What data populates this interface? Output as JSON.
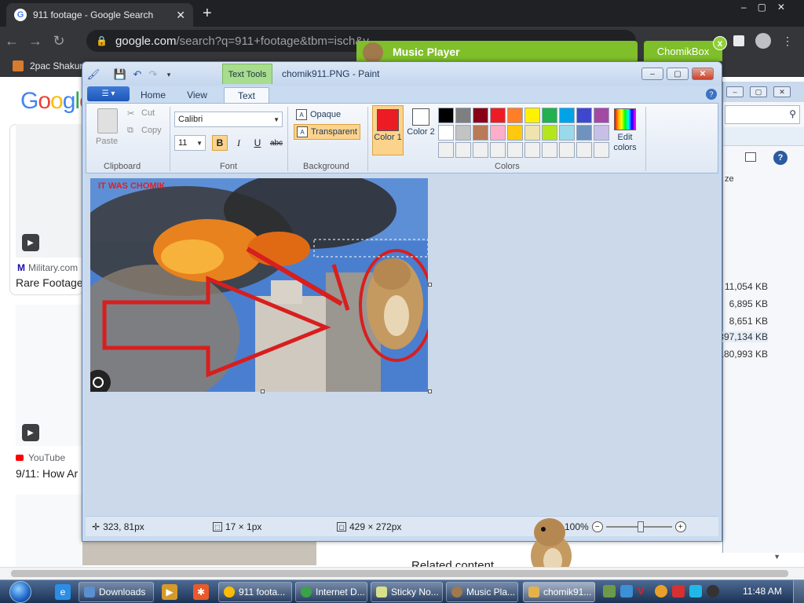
{
  "chrome": {
    "tab_title": "911 footage - Google Search",
    "tab_close": "✕",
    "new_tab": "+",
    "url_host": "google.com",
    "url_rest": "/search?q=911+footage&tbm=isch&v",
    "bookmark": "2pac Shakur"
  },
  "google": {
    "logo": [
      "G",
      "o",
      "o",
      "g",
      "l",
      "e"
    ],
    "result1_source": "Military.com",
    "result1_title": "Rare Footage",
    "result2_source": "YouTube",
    "result2_title": "9/11: How Ar",
    "related": "Related content"
  },
  "explorer": {
    "sizes": [
      "11,054 KB",
      "6,895 KB",
      "8,651 KB",
      "397,134 KB",
      "180,993 KB"
    ],
    "col_header": "ze"
  },
  "music_player": {
    "title": "Music Player"
  },
  "chomikbox": {
    "title": "ChomikBox",
    "close": "x"
  },
  "paint": {
    "doc_title": "chomik911.PNG - Paint",
    "context_tab": "Text Tools",
    "tabs": [
      "Home",
      "View",
      "Text"
    ],
    "active_tab": "Text",
    "clipboard": {
      "paste": "Paste",
      "cut": "Cut",
      "copy": "Copy",
      "label": "Clipboard"
    },
    "font": {
      "family": "Calibri",
      "size": "11",
      "label": "Font",
      "bold": "B",
      "italic": "I",
      "underline": "U",
      "strike": "abc"
    },
    "background": {
      "opaque": "Opaque",
      "transparent": "Transparent",
      "label": "Background"
    },
    "colors": {
      "color1_label": "Color 1",
      "color2_label": "Color 2",
      "color1": "#ed1c24",
      "color2": "#ffffff",
      "palette": [
        "#000000",
        "#7f7f7f",
        "#880015",
        "#ed1c24",
        "#ff7f27",
        "#fff200",
        "#22b14c",
        "#00a2e8",
        "#3f48cc",
        "#a349a4",
        "#ffffff",
        "#c3c3c3",
        "#b97a57",
        "#ffaec9",
        "#ffc90e",
        "#efe4b0",
        "#b5e61d",
        "#99d9ea",
        "#7092be",
        "#c8bfe7",
        "#f0f0f0",
        "#f0f0f0",
        "#f0f0f0",
        "#f0f0f0",
        "#f0f0f0",
        "#f0f0f0",
        "#f0f0f0",
        "#f0f0f0",
        "#f0f0f0",
        "#f0f0f0"
      ],
      "edit_colors": "Edit colors",
      "label": "Colors"
    },
    "canvas_text": "IT WAS CHOMIK",
    "status": {
      "cursor": "323, 81px",
      "selection": "17 × 1px",
      "image_size": "429 × 272px",
      "zoom": "100%"
    }
  },
  "taskbar": {
    "buttons": [
      "Downloads",
      "911 foota...",
      "Internet D...",
      "Sticky No...",
      "Music Pla...",
      "chomik91..."
    ],
    "clock": "11:48 AM"
  }
}
